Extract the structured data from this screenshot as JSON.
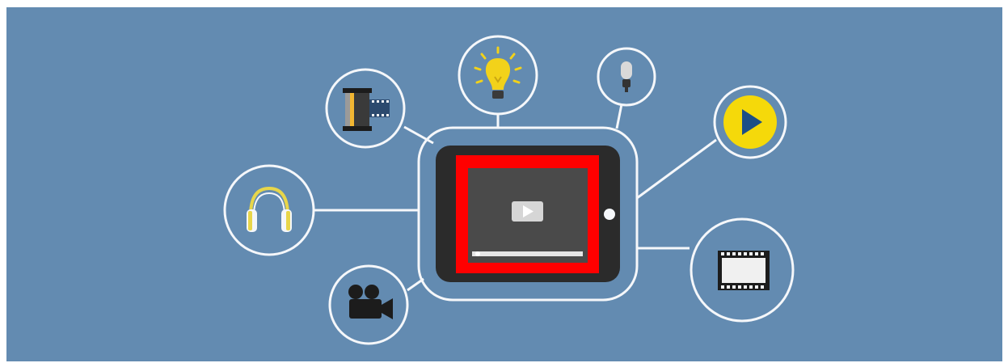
{
  "illustration": {
    "subject": "",
    "colors": {
      "background": "#638bb1",
      "ring": "#f5f7fa",
      "tablet": "#2b2b2b",
      "video_frame": "#ff0000",
      "video_screen": "#4a4a4a",
      "play_badge": "#f5d90a",
      "play_triangle": "#1d4f86",
      "bulb": "#f2d21a",
      "headphones_accent": "#e8d64a",
      "icon_dark": "#1c1c1c"
    },
    "icons": [
      "film-canister-icon",
      "light-bulb-icon",
      "microphone-icon",
      "play-button-icon",
      "headphones-icon",
      "video-camera-icon",
      "film-strip-icon",
      "video-play-icon"
    ]
  }
}
